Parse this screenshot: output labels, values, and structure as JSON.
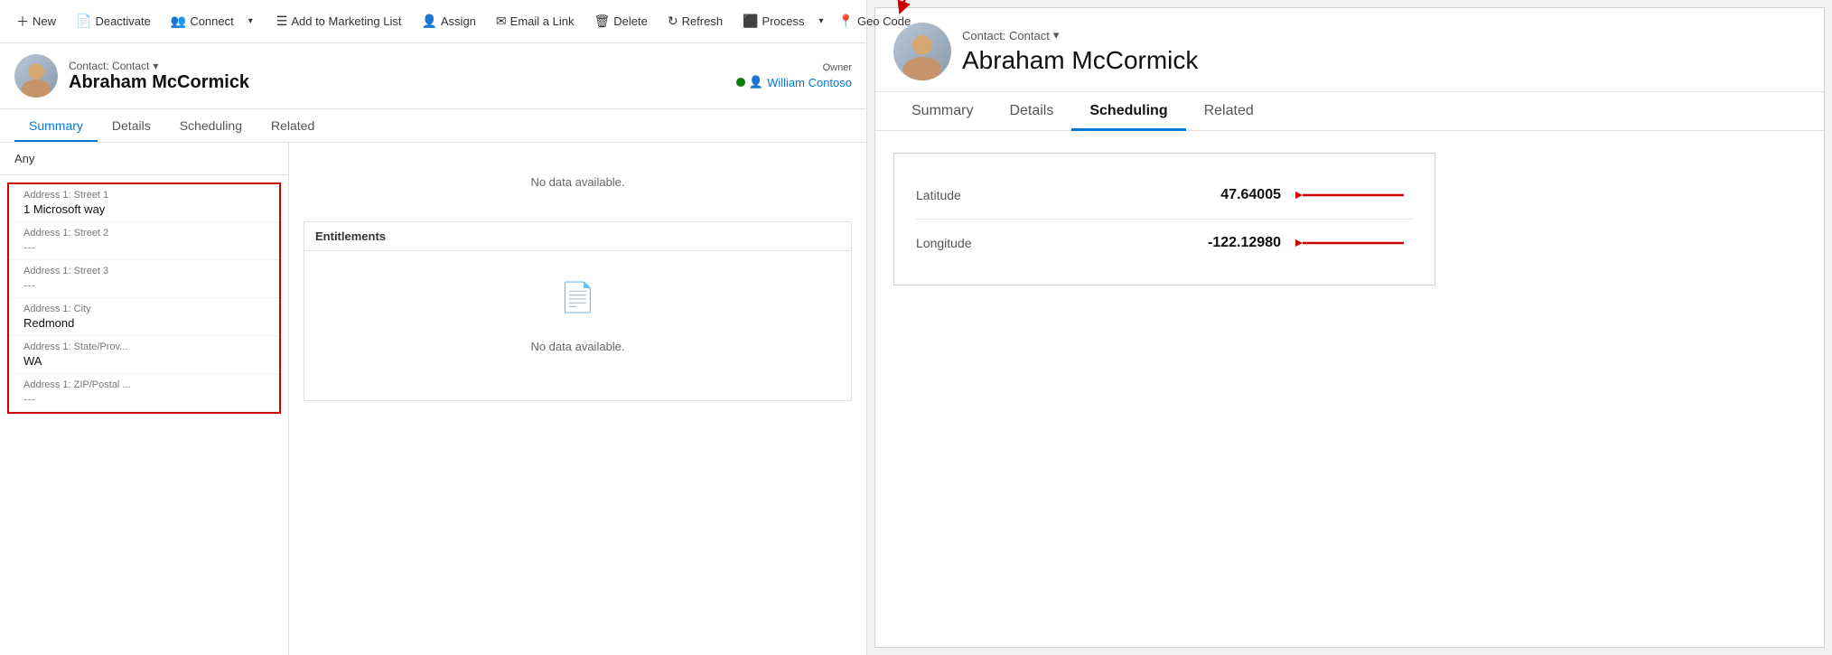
{
  "toolbar": {
    "new_label": "New",
    "deactivate_label": "Deactivate",
    "connect_label": "Connect",
    "marketing_label": "Add to Marketing List",
    "assign_label": "Assign",
    "email_label": "Email a Link",
    "delete_label": "Delete",
    "refresh_label": "Refresh",
    "process_label": "Process",
    "geocode_label": "Geo Code"
  },
  "contact": {
    "type": "Contact: Contact",
    "name": "Abraham McCormick",
    "owner_label": "Owner",
    "owner_name": "William Contoso"
  },
  "tabs": {
    "summary": "Summary",
    "details": "Details",
    "scheduling": "Scheduling",
    "related": "Related"
  },
  "form": {
    "any": "Any",
    "address_fields": [
      {
        "label": "Address 1: Street 1",
        "value": "1 Microsoft way"
      },
      {
        "label": "Address 1: Street 2",
        "value": "---"
      },
      {
        "label": "Address 1: Street 3",
        "value": "---"
      },
      {
        "label": "Address 1: City",
        "value": "Redmond"
      },
      {
        "label": "Address 1: State/Prov...",
        "value": "WA"
      },
      {
        "label": "Address 1: ZIP/Postal ...",
        "value": "---"
      }
    ],
    "no_data_top": "No data available.",
    "entitlements_label": "Entitlements",
    "no_data_bottom": "No data available."
  },
  "right_panel": {
    "contact_type": "Contact: Contact",
    "contact_name": "Abraham McCormick",
    "tabs": {
      "summary": "Summary",
      "details": "Details",
      "scheduling": "Scheduling",
      "related": "Related"
    },
    "geo": {
      "latitude_label": "Latitude",
      "latitude_value": "47.64005",
      "longitude_label": "Longitude",
      "longitude_value": "-122.12980"
    }
  }
}
